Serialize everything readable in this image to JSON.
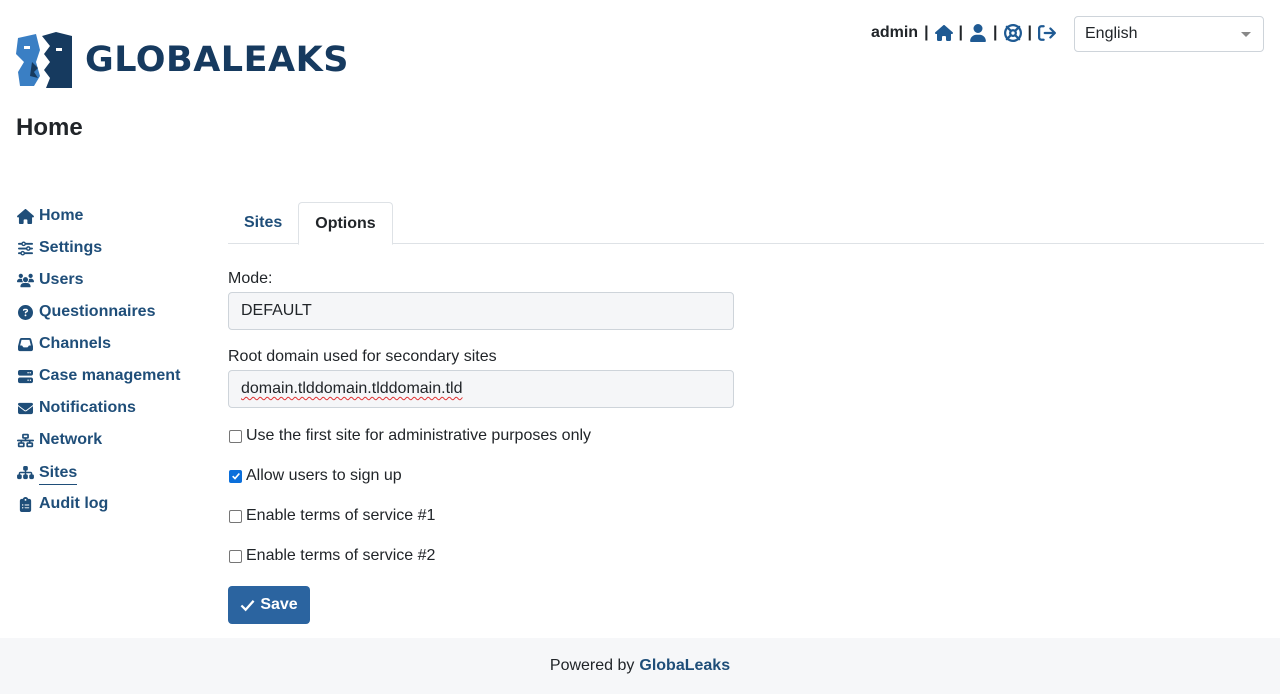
{
  "brand": {
    "logo_text": "GLOBALEAKS"
  },
  "header": {
    "username": "admin",
    "separator": "|",
    "icons": [
      "home-icon",
      "user-icon",
      "lifebuoy-icon",
      "sign-out-icon"
    ],
    "language": "English"
  },
  "page": {
    "title": "Home"
  },
  "sidebar": {
    "items": [
      {
        "label": "Home",
        "icon": "home-icon"
      },
      {
        "label": "Settings",
        "icon": "sliders-icon"
      },
      {
        "label": "Users",
        "icon": "users-icon"
      },
      {
        "label": "Questionnaires",
        "icon": "question-circle-icon"
      },
      {
        "label": "Channels",
        "icon": "inbox-icon"
      },
      {
        "label": "Case management",
        "icon": "server-icon"
      },
      {
        "label": "Notifications",
        "icon": "envelope-icon"
      },
      {
        "label": "Network",
        "icon": "network-icon"
      },
      {
        "label": "Sites",
        "icon": "sitemap-icon",
        "active": true
      },
      {
        "label": "Audit log",
        "icon": "clipboard-icon"
      }
    ]
  },
  "tabs": [
    {
      "label": "Sites"
    },
    {
      "label": "Options",
      "active": true
    }
  ],
  "form": {
    "mode_label": "Mode:",
    "mode_value": "DEFAULT",
    "root_domain_label": "Root domain used for secondary sites",
    "root_domain_value": "domain.tlddomain.tlddomain.tld",
    "checkboxes": [
      {
        "label": "Use the first site for administrative purposes only",
        "checked": false
      },
      {
        "label": "Allow users to sign up",
        "checked": true
      },
      {
        "label": "Enable terms of service #1",
        "checked": false
      },
      {
        "label": "Enable terms of service #2",
        "checked": false
      }
    ],
    "save_label": "Save"
  },
  "footer": {
    "prefix": "Powered by",
    "brand": "GlobaLeaks"
  },
  "colors": {
    "primary": "#1f4e79",
    "button": "#2b64a0",
    "logo_dark": "#163a5f",
    "logo_light": "#3a7fc4",
    "checkbox": "#0b6fdb"
  }
}
